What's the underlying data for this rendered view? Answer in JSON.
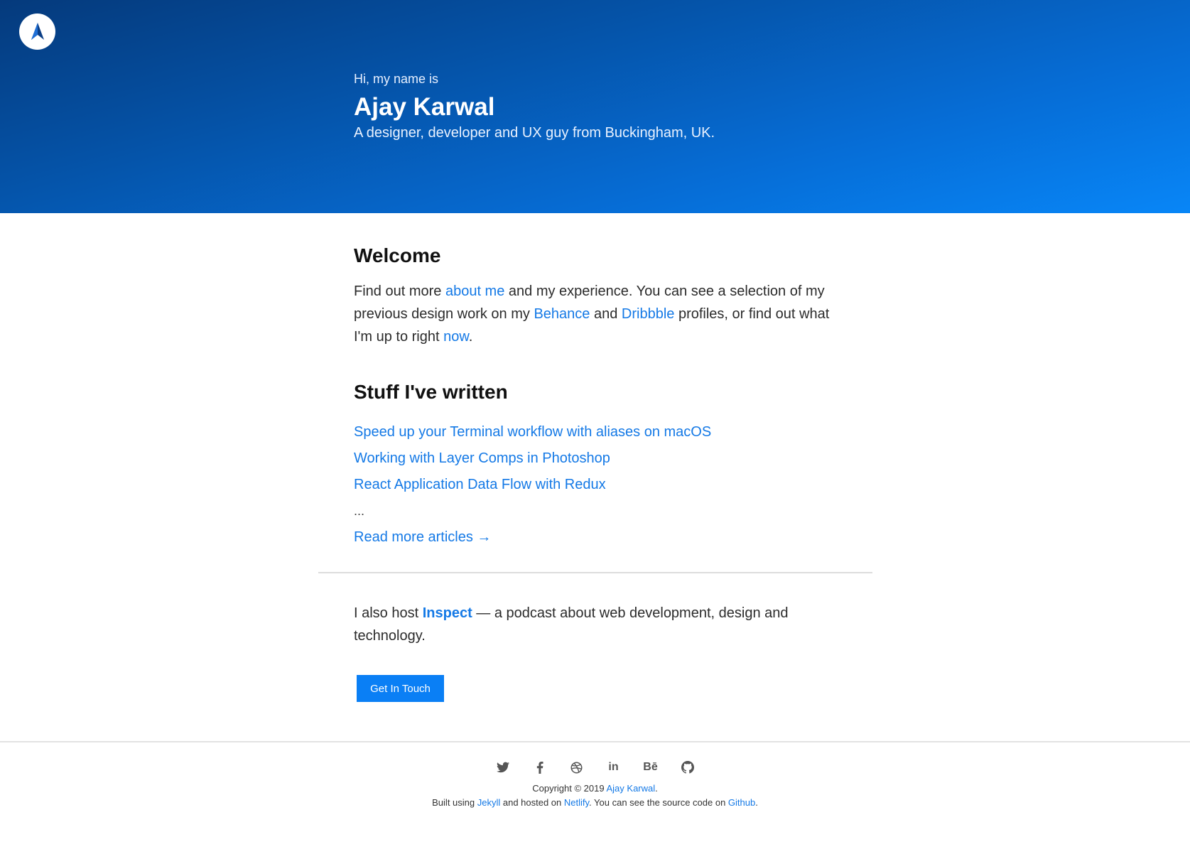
{
  "hero": {
    "greeting": "Hi, my name is",
    "name": "Ajay Karwal",
    "tagline": "A designer, developer and UX guy from Buckingham, UK.",
    "logo_icon": "ak-logo-icon"
  },
  "welcome": {
    "heading": "Welcome",
    "text_1": "Find out more ",
    "link_about": "about me",
    "text_2": " and my experience. You can see a selection of my previous design work on my ",
    "link_behance": "Behance",
    "text_3": " and ",
    "link_dribbble": "Dribbble",
    "text_4": " profiles, or find out what I'm up to right ",
    "link_now": "now",
    "text_5": "."
  },
  "articles": {
    "heading": "Stuff I've written",
    "items": [
      "Speed up your Terminal workflow with aliases on macOS",
      "Working with Layer Comps in Photoshop",
      "React Application Data Flow with Redux"
    ],
    "ellipsis": "...",
    "read_more": "Read more articles →"
  },
  "podcast": {
    "text_1": "I also host ",
    "link": "Inspect",
    "text_2": " — a podcast about web development, design and technology."
  },
  "cta": {
    "label": "Get In Touch"
  },
  "footer": {
    "socials": [
      {
        "icon": "twitter-icon"
      },
      {
        "icon": "facebook-icon"
      },
      {
        "icon": "dribbble-icon"
      },
      {
        "icon": "linkedin-icon",
        "label": "in"
      },
      {
        "icon": "behance-icon",
        "label": "Bē"
      },
      {
        "icon": "github-icon"
      }
    ],
    "copyright_prefix": "Copyright © 2019 ",
    "copyright_link": "Ajay Karwal",
    "copyright_suffix": ".",
    "built_1": "Built using ",
    "built_jekyll": "Jekyll",
    "built_2": " and hosted on ",
    "built_netlify": "Netlify",
    "built_3": ". You can see the source code on ",
    "built_github": "Github",
    "built_4": "."
  },
  "colors": {
    "link": "#1479e6",
    "button": "#0a7ff5",
    "hero_start": "#053a7c",
    "hero_end": "#0886f7"
  }
}
